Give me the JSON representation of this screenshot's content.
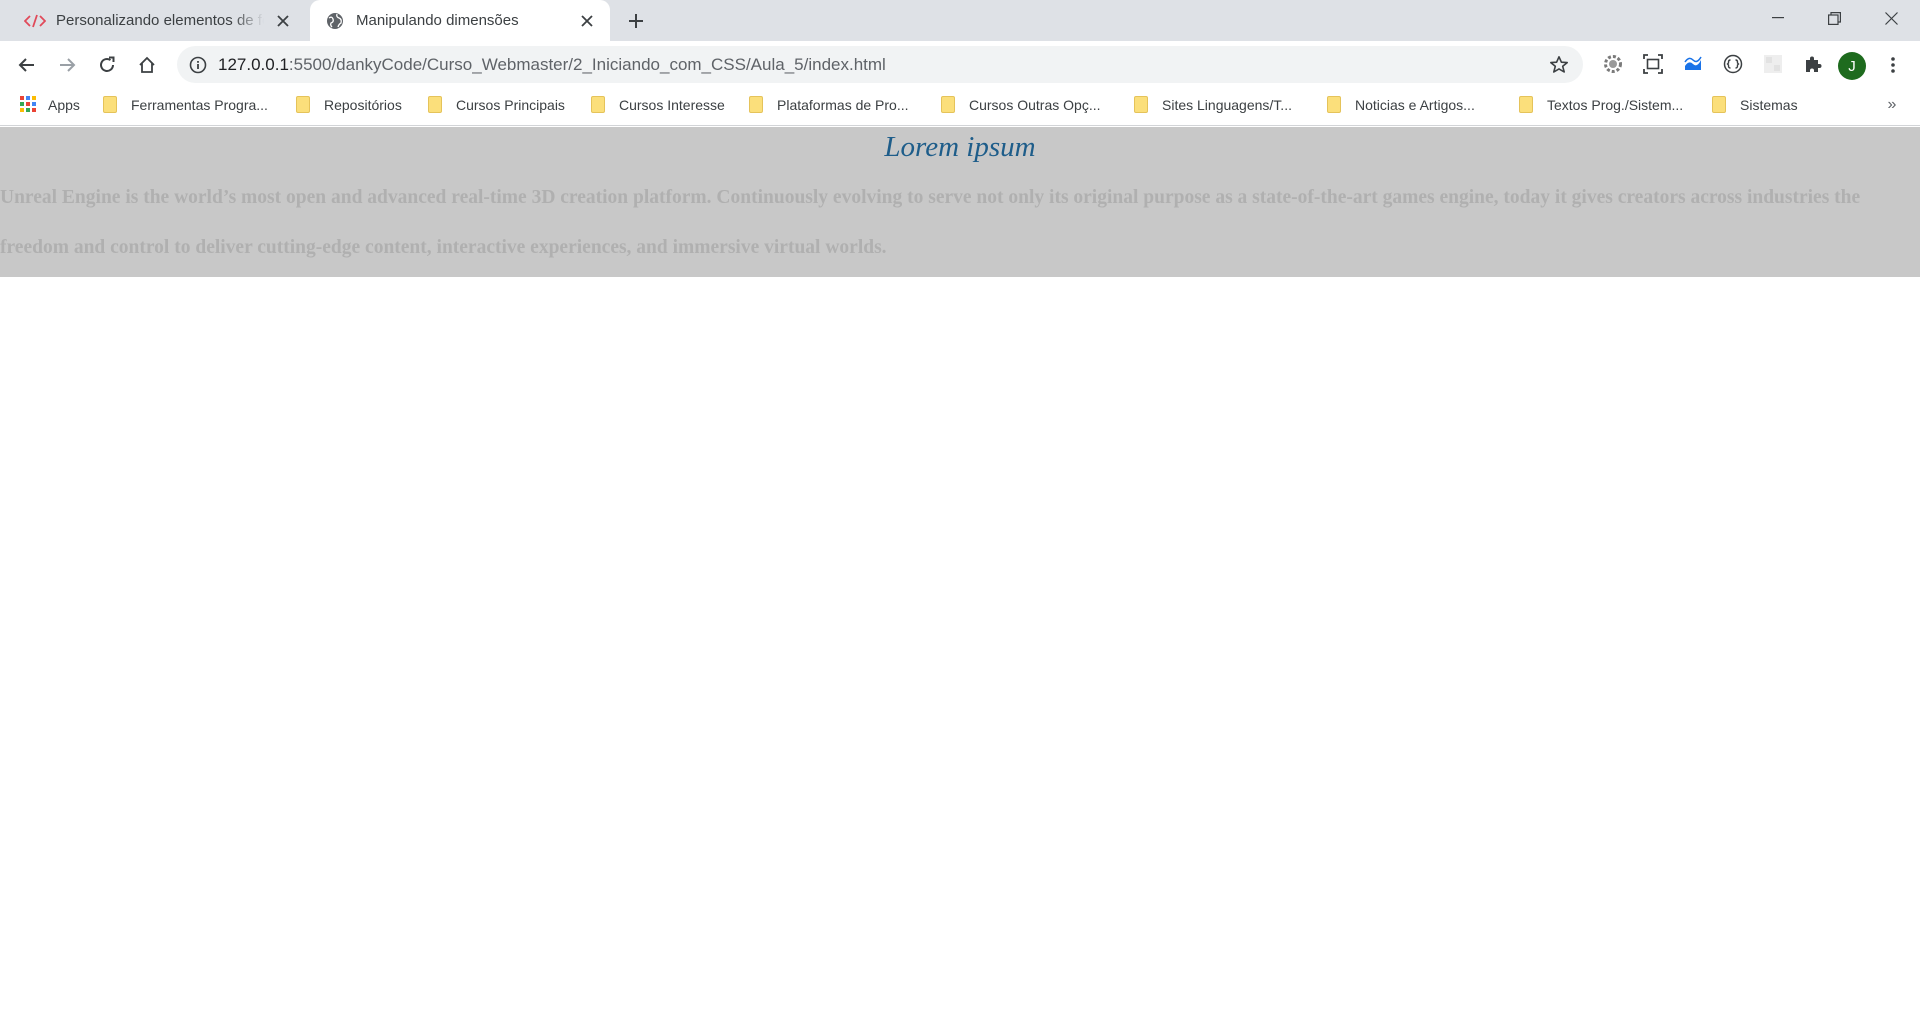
{
  "browser": {
    "tabs": [
      {
        "title": "Personalizando elementos de formulário",
        "active": false
      },
      {
        "title": "Manipulando dimensões",
        "active": true
      }
    ],
    "url": {
      "host": "127.0.0.1",
      "rest": ":5500/dankyCode/Curso_Webmaster/2_Iniciando_com_CSS/Aula_5/index.html"
    },
    "profile_initial": "J",
    "bookmarks": {
      "apps_label": "Apps",
      "items": [
        "Ferramentas Progra...",
        "Repositórios",
        "Cursos Principais",
        "Cursos Interesse",
        "Plataformas de Pro...",
        "Cursos Outras Opç...",
        "Sites Linguagens/T...",
        "Noticias e Artigos...",
        "Textos Prog./Sistem...",
        "Sistemas"
      ],
      "more": "»"
    }
  },
  "page": {
    "heading": "Lorem ipsum",
    "paragraph": "Unreal Engine is the world’s most open and advanced real-time 3D creation platform. Continuously evolving to serve not only its original purpose as a state-of-the-art games engine, today it gives creators across industries the freedom and control to deliver cutting-edge content, interactive experiences, and immersive virtual worlds."
  },
  "colors": {
    "content_background": "#c8c8c8",
    "heading": "#1e5d8a",
    "paragraph": "#b0b0b0",
    "avatar": "#1e6b1e"
  }
}
